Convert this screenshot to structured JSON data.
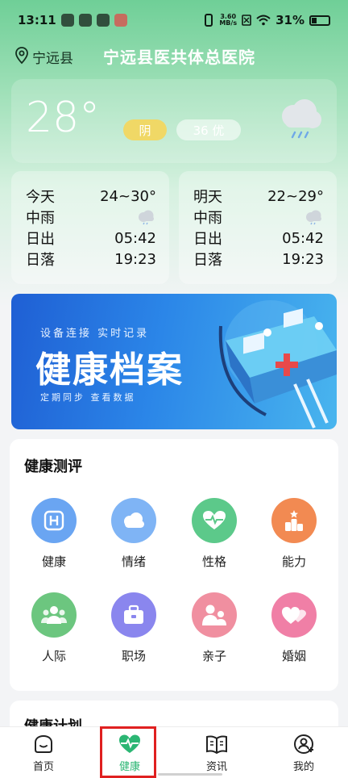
{
  "status_bar": {
    "time": "13:11",
    "net_speed_top": "3.60",
    "net_speed_bottom": "MB/s",
    "battery": "31%"
  },
  "header": {
    "location": "宁远县",
    "hospital": "宁远县医共体总医院"
  },
  "weather_now": {
    "temperature": "28°",
    "condition": "阴",
    "aqi": "36 优",
    "condition_color": "#f0d866",
    "icon": "cloud-rain-icon"
  },
  "forecast": [
    {
      "day": "今天",
      "range": "24~30°",
      "condition": "中雨",
      "sunrise_label": "日出",
      "sunrise": "05:42",
      "sunset_label": "日落",
      "sunset": "19:23"
    },
    {
      "day": "明天",
      "range": "22~29°",
      "condition": "中雨",
      "sunrise_label": "日出",
      "sunrise": "05:42",
      "sunset_label": "日落",
      "sunset": "19:23"
    }
  ],
  "banner": {
    "top_text": "设备连接  实时记录",
    "title": "健康档案",
    "bottom_text": "定期同步      查看数据"
  },
  "assessment": {
    "title": "健康测评",
    "items": [
      {
        "label": "健康",
        "color": "#6aa5f2",
        "icon": "h-square-icon"
      },
      {
        "label": "情绪",
        "color": "#7fb4f5",
        "icon": "cloud-icon"
      },
      {
        "label": "性格",
        "color": "#5cc98a",
        "icon": "heart-pulse-icon"
      },
      {
        "label": "能力",
        "color": "#f28a52",
        "icon": "podium-icon"
      },
      {
        "label": "人际",
        "color": "#6cc67f",
        "icon": "people-icon"
      },
      {
        "label": "职场",
        "color": "#8a86ee",
        "icon": "briefcase-icon"
      },
      {
        "label": "亲子",
        "color": "#f08fa0",
        "icon": "parent-child-icon"
      },
      {
        "label": "婚姻",
        "color": "#f07fa6",
        "icon": "hearts-icon"
      }
    ]
  },
  "plan": {
    "title": "健康计划"
  },
  "tabbar": {
    "tabs": [
      {
        "label": "首页",
        "icon": "home-icon"
      },
      {
        "label": "健康",
        "icon": "health-heart-icon"
      },
      {
        "label": "资讯",
        "icon": "book-icon"
      },
      {
        "label": "我的",
        "icon": "profile-icon"
      }
    ],
    "active_color": "#2bb673"
  }
}
